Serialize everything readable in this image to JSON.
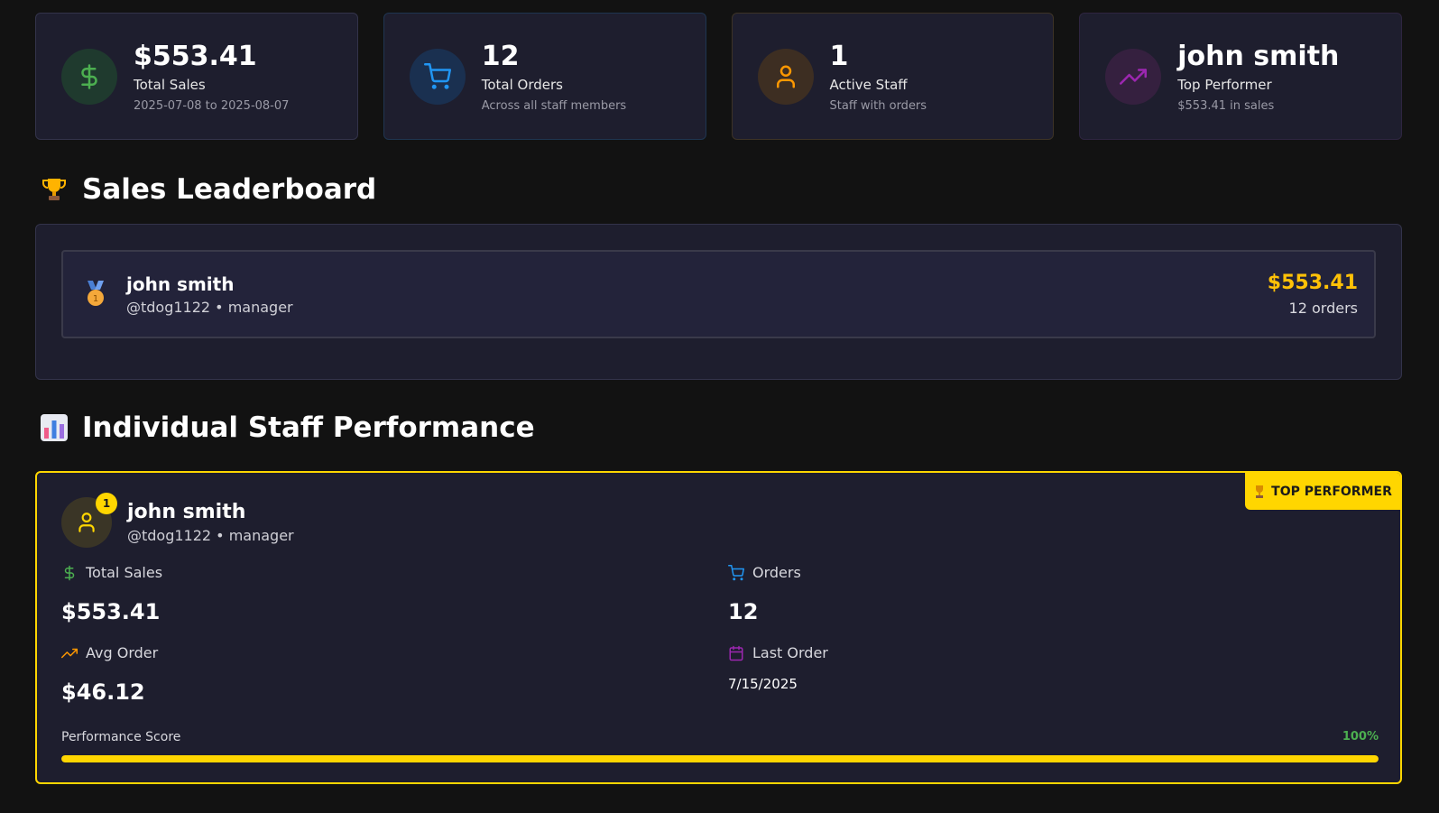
{
  "stats": [
    {
      "value": "$553.41",
      "label": "Total Sales",
      "sub": "2025-07-08 to 2025-08-07",
      "icon": "dollar-icon"
    },
    {
      "value": "12",
      "label": "Total Orders",
      "sub": "Across all staff members",
      "icon": "cart-icon"
    },
    {
      "value": "1",
      "label": "Active Staff",
      "sub": "Staff with orders",
      "icon": "user-icon"
    },
    {
      "value": "john smith",
      "label": "Top Performer",
      "sub": "$553.41 in sales",
      "icon": "trending-up-icon"
    }
  ],
  "leaderboard": {
    "title": "Sales Leaderboard",
    "entries": [
      {
        "rank": "1",
        "name": "john smith",
        "meta": "@tdog1122 • manager",
        "sales": "$553.41",
        "orders": "12 orders"
      }
    ]
  },
  "performance": {
    "title": "Individual Staff Performance",
    "badge": "TOP PERFORMER",
    "rank": "1",
    "name": "john smith",
    "meta": "@tdog1122 • manager",
    "total_sales_label": "Total Sales",
    "total_sales": "$553.41",
    "orders_label": "Orders",
    "orders": "12",
    "avg_order_label": "Avg Order",
    "avg_order": "$46.12",
    "last_order_label": "Last Order",
    "last_order": "7/15/2025",
    "score_label": "Performance Score",
    "score_text": "100%",
    "score_fraction": 1.0
  },
  "colors": {
    "accent_gold": "#ffd600",
    "green": "#4caf50",
    "blue": "#2196f3",
    "orange": "#ff9800",
    "purple": "#9c27b0"
  }
}
